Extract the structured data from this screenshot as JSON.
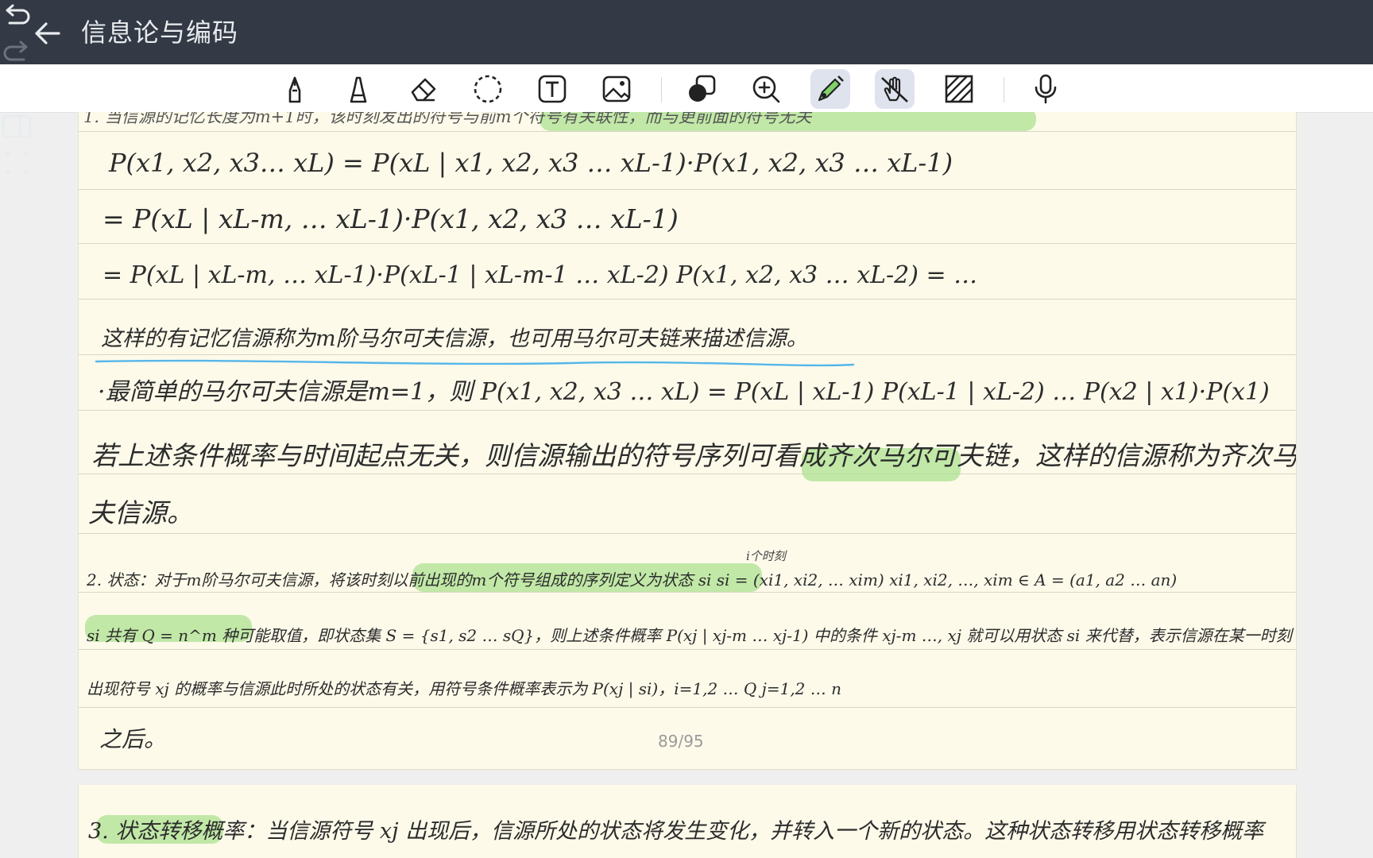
{
  "header": {
    "title": "信息论与编码"
  },
  "page": {
    "indicator": "89/95",
    "lines": [
      "1. 当信源的记忆长度为m+1时，该时刻发出的符号与前m个符号有关联性，而与更前面的符号无关",
      "P(x1, x2, x3… xL) = P(xL | x1, x2, x3 … xL-1)·P(x1, x2, x3 … xL-1)",
      "= P(xL | xL-m, … xL-1)·P(x1, x2, x3 … xL-1)",
      "= P(xL | xL-m, … xL-1)·P(xL-1 | xL-m-1 … xL-2) P(x1, x2, x3 … xL-2) = …",
      "这样的有记忆信源称为m阶马尔可夫信源，也可用马尔可夫链来描述信源。",
      "·最简单的马尔可夫信源是m=1，则 P(x1, x2, x3 … xL) = P(xL | xL-1) P(xL-1 | xL-2) … P(x2 | x1)·P(x1)",
      "若上述条件概率与时间起点无关，则信源输出的符号序列可看成齐次马尔可夫链，这样的信源称为齐次马尔可",
      "夫信源。",
      "2. 状态：对于m阶马尔可夫信源，将该时刻以前出现的m个符号组成的序列定义为状态 si   si = (xi1, xi2, … xim)   xi1, xi2, …, xim ∈ A = (a1, a2 … an)",
      "si 共有 Q = n^m 种可能取值，即状态集 S = {s1, s2 … sQ}，则上述条件概率 P(xj | xj-m … xj-1) 中的条件 xj-m …, xj 就可以用状态 si 来代替，表示信源在某一时刻",
      "出现符号 xj 的概率与信源此时所处的状态有关，用符号条件概率表示为 P(xj | si)，i=1,2 … Q  j=1,2 … n",
      "之后。"
    ],
    "annotation": "i个时刻"
  },
  "next_page": {
    "line": "3. 状态转移概率：当信源符号 xj 出现后，信源所处的状态将发生变化，并转入一个新的状态。这种状态转移用状态转移概率"
  },
  "colors": {
    "topbar": "#333a45",
    "page": "#fdfaea",
    "highlight": "#a7e08a",
    "active_tool": "#dfe3ee"
  },
  "icons": {
    "top": [
      "back-arrow-icon",
      "undo-icon",
      "redo-icon",
      "add-icon",
      "split-view-icon",
      "more-icon"
    ],
    "tools": [
      "pen-icon",
      "highlighter-icon",
      "eraser-icon",
      "lasso-icon",
      "text-icon",
      "image-icon",
      "shape-icon",
      "zoom-icon",
      "highlight-pen-icon",
      "touch-draw-icon",
      "pattern-icon",
      "microphone-icon"
    ]
  }
}
